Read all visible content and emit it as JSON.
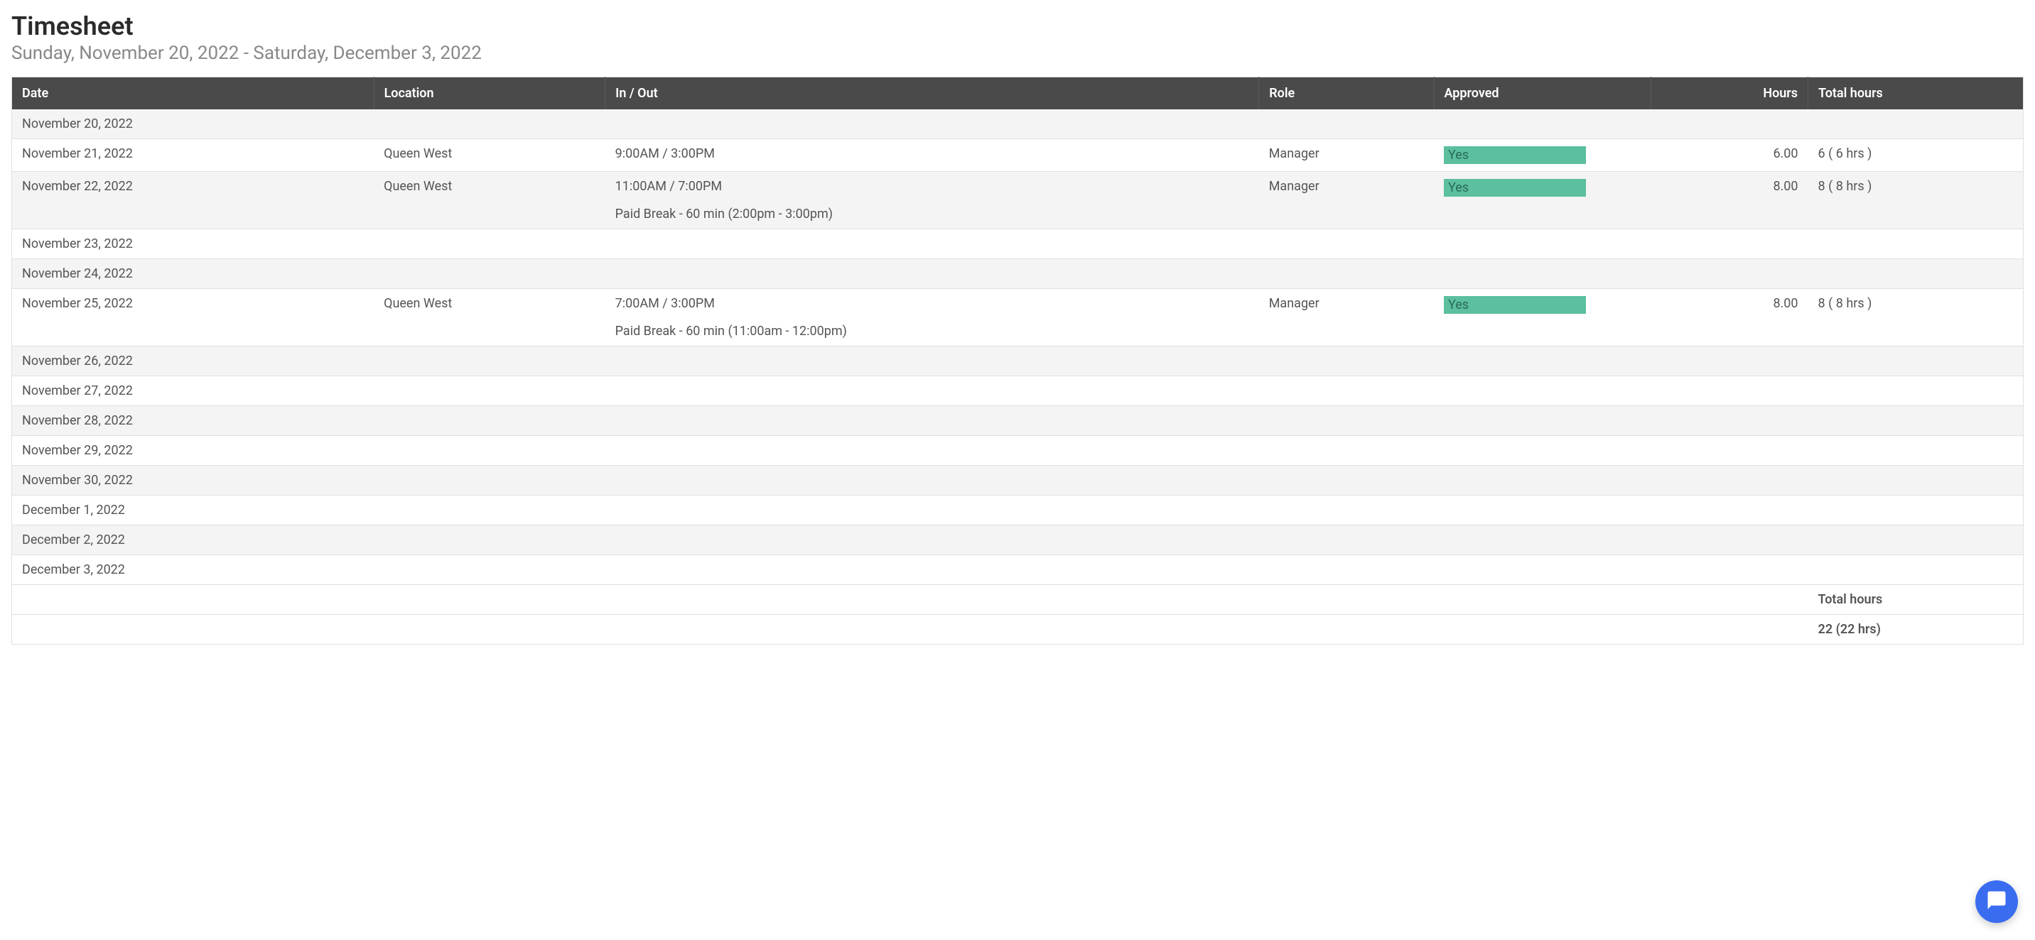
{
  "header": {
    "title": "Timesheet",
    "subtitle": "Sunday, November 20, 2022 - Saturday, December 3, 2022"
  },
  "columns": {
    "date": "Date",
    "location": "Location",
    "inout": "In / Out",
    "role": "Role",
    "approved": "Approved",
    "hours": "Hours",
    "total_hours": "Total hours"
  },
  "rows": [
    {
      "date": "November 20, 2022"
    },
    {
      "date": "November 21, 2022",
      "location": "Queen West",
      "inout": "9:00AM / 3:00PM",
      "role": "Manager",
      "approved": "Yes",
      "hours": "6.00",
      "total_hours": "6 ( 6 hrs )"
    },
    {
      "date": "November 22, 2022",
      "location": "Queen West",
      "inout": "11:00AM / 7:00PM",
      "break": "Paid Break - 60 min (2:00pm - 3:00pm)",
      "role": "Manager",
      "approved": "Yes",
      "hours": "8.00",
      "total_hours": "8 ( 8 hrs )"
    },
    {
      "date": "November 23, 2022"
    },
    {
      "date": "November 24, 2022"
    },
    {
      "date": "November 25, 2022",
      "location": "Queen West",
      "inout": "7:00AM / 3:00PM",
      "break": "Paid Break - 60 min (11:00am - 12:00pm)",
      "role": "Manager",
      "approved": "Yes",
      "hours": "8.00",
      "total_hours": "8 ( 8 hrs )"
    },
    {
      "date": "November 26, 2022"
    },
    {
      "date": "November 27, 2022"
    },
    {
      "date": "November 28, 2022"
    },
    {
      "date": "November 29, 2022"
    },
    {
      "date": "November 30, 2022"
    },
    {
      "date": "December 1, 2022"
    },
    {
      "date": "December 2, 2022"
    },
    {
      "date": "December 3, 2022"
    }
  ],
  "summary": {
    "label": "Total hours",
    "value": "22 (22 hrs)"
  }
}
